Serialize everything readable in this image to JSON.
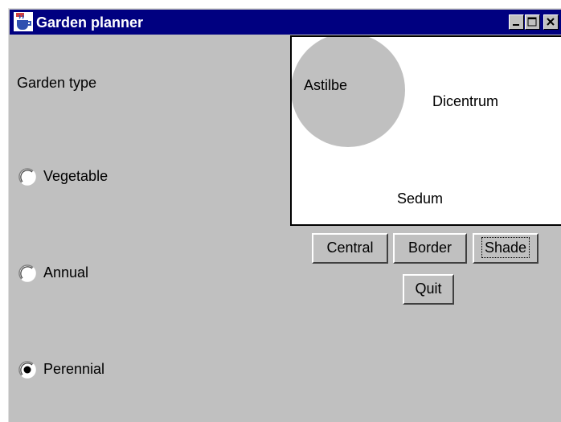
{
  "window": {
    "title": "Garden planner",
    "controls": [
      "minimize-icon",
      "maximize-icon",
      "close-icon"
    ]
  },
  "garden_type": {
    "label": "Garden type",
    "options": [
      {
        "label": "Vegetable",
        "selected": false
      },
      {
        "label": "Annual",
        "selected": false
      },
      {
        "label": "Perennial",
        "selected": true
      }
    ]
  },
  "canvas": {
    "plants": {
      "astilbe": "Astilbe",
      "dicentrum": "Dicentrum",
      "sedum": "Sedum"
    },
    "highlight_color": "#c0c0c0"
  },
  "buttons": {
    "central": "Central",
    "border": "Border",
    "shade": "Shade",
    "quit": "Quit"
  },
  "colors": {
    "titlebar": "#000080",
    "window_bg": "#c0c0c0"
  }
}
